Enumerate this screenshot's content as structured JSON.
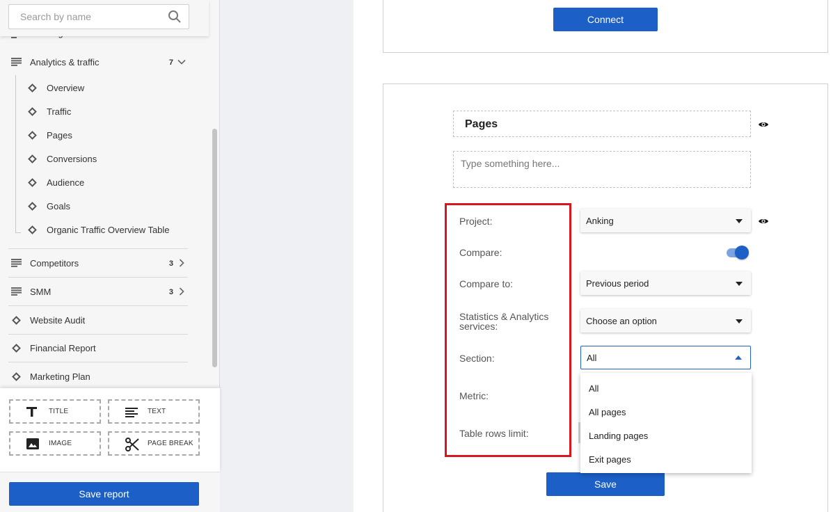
{
  "sidebar": {
    "search": {
      "placeholder": "Search by name"
    },
    "cut_item_label": "Rankings",
    "groups": [
      {
        "label": "Analytics & traffic",
        "count": "7",
        "expanded": true
      },
      {
        "label": "Competitors",
        "count": "3",
        "expanded": false
      },
      {
        "label": "SMM",
        "count": "3",
        "expanded": false
      }
    ],
    "analytics_items": [
      {
        "label": "Overview"
      },
      {
        "label": "Traffic"
      },
      {
        "label": "Pages"
      },
      {
        "label": "Conversions"
      },
      {
        "label": "Audience"
      },
      {
        "label": "Goals"
      },
      {
        "label": "Organic Traffic Overview Table"
      }
    ],
    "single_items": [
      {
        "label": "Website Audit"
      },
      {
        "label": "Financial Report"
      },
      {
        "label": "Marketing Plan"
      }
    ],
    "widgets": {
      "title": "TITLE",
      "text": "TEXT",
      "image": "IMAGE",
      "page_break": "PAGE BREAK"
    },
    "save_report": "Save report"
  },
  "main": {
    "connect_label": "Connect",
    "widget_title": "Pages",
    "description_placeholder": "Type something here...",
    "fields": {
      "project": {
        "label": "Project:",
        "value": "Anking"
      },
      "compare": {
        "label": "Compare:",
        "enabled": true
      },
      "compare_to": {
        "label": "Compare to:",
        "value": "Previous period"
      },
      "stats_services": {
        "label": "Statistics & Analytics services:",
        "value": "Choose an option"
      },
      "section": {
        "label": "Section:",
        "value": "All"
      },
      "metric": {
        "label": "Metric:"
      },
      "table_rows_limit": {
        "label": "Table rows limit:"
      }
    },
    "section_options": [
      "All",
      "All pages",
      "Landing pages",
      "Exit pages"
    ],
    "save_label": "Save"
  },
  "colors": {
    "primary": "#1c5fc6",
    "highlight": "#d8161f"
  }
}
